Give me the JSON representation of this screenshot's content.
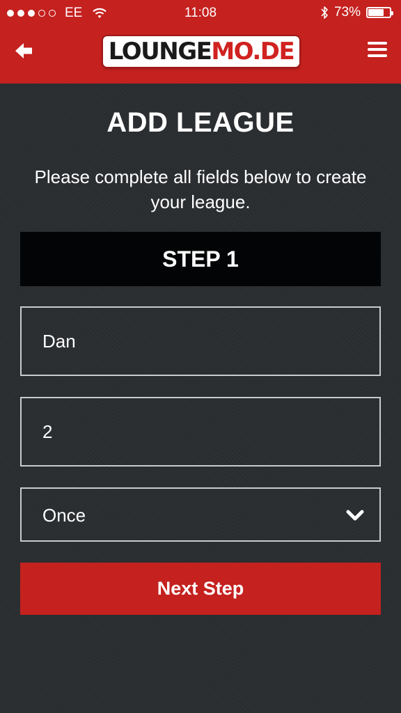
{
  "status_bar": {
    "signal_dots_filled": 3,
    "signal_dots_total": 5,
    "carrier": "EE",
    "time": "11:08",
    "battery_percent": "73%",
    "battery_level": 0.73
  },
  "header": {
    "logo_part1": "LOUNGE",
    "logo_part2": "MO.DE",
    "back_icon": "arrow-left-icon",
    "menu_icon": "hamburger-menu-icon"
  },
  "page": {
    "title": "ADD LEAGUE",
    "intro": "Please complete all fields below to create your league.",
    "step_label": "STEP 1"
  },
  "form": {
    "name_value": "Dan",
    "number_value": "2",
    "frequency_selected": "Once",
    "next_button_label": "Next Step"
  },
  "colors": {
    "brand_red": "#c4211f",
    "background": "#2b2e31",
    "step_header": "#020405",
    "field_border": "#c9cbcd"
  }
}
